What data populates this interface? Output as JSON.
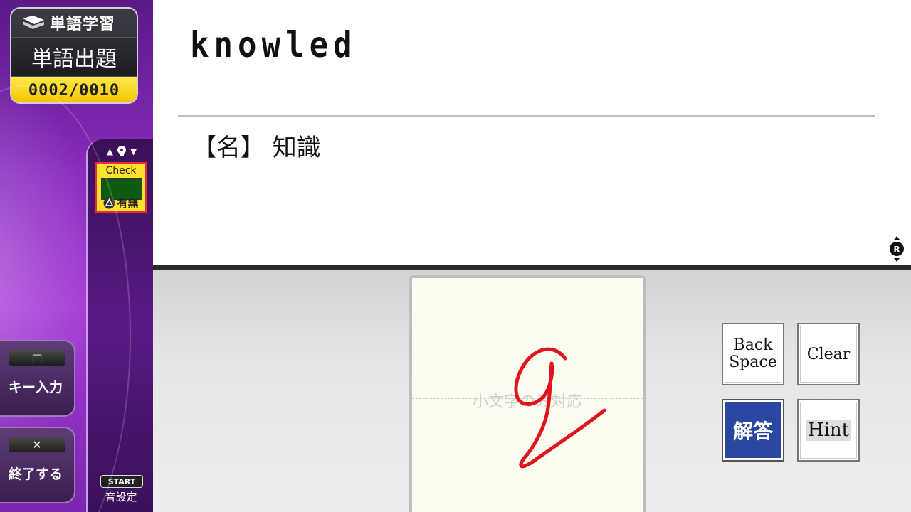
{
  "sidebar": {
    "app_title": "単語学習",
    "mode": "単語出題",
    "counter": "0002/0010",
    "check": {
      "label": "Check",
      "toggle_label": "有無"
    },
    "key_input": {
      "key_glyph": "□",
      "label": "キー入力"
    },
    "exit": {
      "key_glyph": "✕",
      "label": "終了する"
    },
    "sound": {
      "badge": "START",
      "label": "音設定"
    }
  },
  "question": {
    "word": "knowled",
    "meaning": "【名】 知識"
  },
  "handwriting": {
    "placeholder": "小文字のみ対応",
    "stroke_color": "#e0141c"
  },
  "buttons": {
    "backspace_line1": "Back",
    "backspace_line2": "Space",
    "clear": "Clear",
    "answer": "解答",
    "hint": "Hint"
  },
  "colors": {
    "sidebar_purple": "#8a2cc0",
    "counter_yellow": "#f2c200",
    "answer_blue": "#2a46a0",
    "check_border": "#e0303a"
  }
}
